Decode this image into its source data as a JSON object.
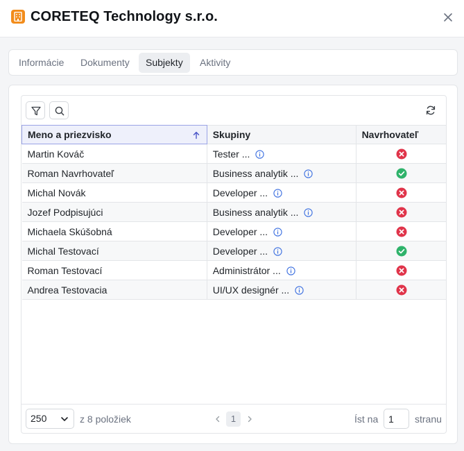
{
  "header": {
    "title": "CORETEQ Technology s.r.o."
  },
  "tabs": [
    {
      "label": "Informácie"
    },
    {
      "label": "Dokumenty"
    },
    {
      "label": "Subjekty"
    },
    {
      "label": "Aktivity"
    }
  ],
  "active_tab": "Subjekty",
  "table": {
    "columns": [
      "Meno a priezvisko",
      "Skupiny",
      "Navrhovateľ"
    ],
    "sorted_column": "Meno a priezvisko",
    "sort_direction": "ascending",
    "rows": [
      {
        "name": "Martin Kováč",
        "group": "Tester ...",
        "proposer": false
      },
      {
        "name": "Roman Navrhovateľ",
        "group": "Business analytik ...",
        "proposer": true
      },
      {
        "name": "Michal Novák",
        "group": "Developer ...",
        "proposer": false
      },
      {
        "name": "Jozef Podpisujúci",
        "group": "Business analytik ...",
        "proposer": false
      },
      {
        "name": "Michaela Skúšobná",
        "group": "Developer ...",
        "proposer": false
      },
      {
        "name": "Michal Testovací",
        "group": "Developer ...",
        "proposer": true
      },
      {
        "name": "Roman Testovací",
        "group": "Administrátor ...",
        "proposer": false
      },
      {
        "name": "Andrea Testovacia",
        "group": "UI/UX designér ...",
        "proposer": false
      }
    ]
  },
  "footer": {
    "page_size": "250",
    "count_label": "z 8 položiek",
    "current_page": "1",
    "goto_label": "Íst na",
    "goto_value": "1",
    "goto_suffix": "stranu"
  },
  "colors": {
    "brand": "#f28c1b",
    "yes": "#2fb36b",
    "no": "#e0344a",
    "info": "#3b6fe0",
    "sort_accent": "#4a55c8"
  },
  "icons": {
    "logo": "building-icon",
    "close": "close-icon",
    "filter": "filter-icon",
    "search": "search-icon",
    "refresh": "refresh-icon",
    "sort": "arrow-up-icon",
    "info": "info-icon",
    "yes": "check-circle-icon",
    "no": "x-circle-icon"
  }
}
